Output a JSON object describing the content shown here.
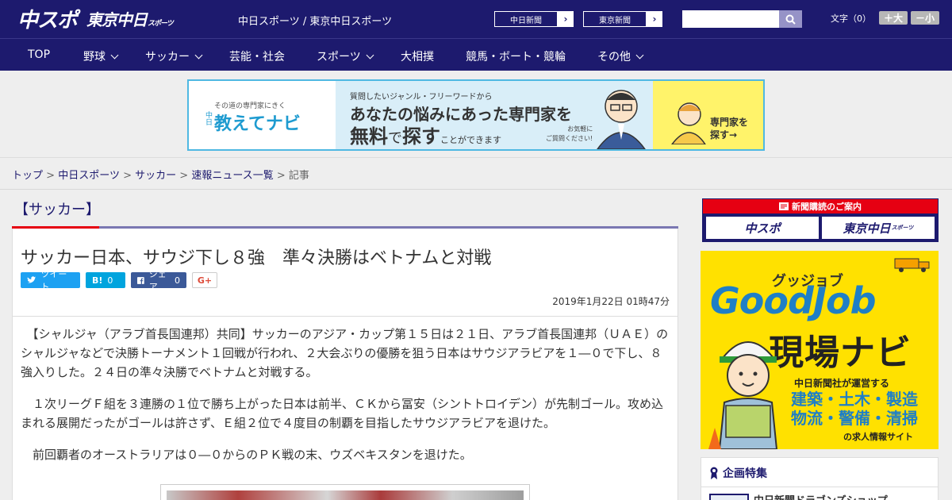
{
  "header": {
    "logo_main": "中スポ",
    "logo_tokyo": "東京中日",
    "logo_tokyo_small": "スポーツ",
    "site_names": "中日スポーツ / 東京中日スポーツ",
    "links": [
      {
        "label": "中日新聞",
        "arrow": "›"
      },
      {
        "label": "東京新聞",
        "arrow": "›"
      }
    ],
    "search_placeholder": "",
    "font_size_label": "文字（0）",
    "font_larger": "＋大",
    "font_smaller": "－小",
    "search_icon": "search-icon"
  },
  "nav": {
    "items": [
      {
        "label": "TOP",
        "dropdown": false
      },
      {
        "label": "野球",
        "dropdown": true
      },
      {
        "label": "サッカー",
        "dropdown": true
      },
      {
        "label": "芸能・社会",
        "dropdown": false
      },
      {
        "label": "スポーツ",
        "dropdown": true
      },
      {
        "label": "大相撲",
        "dropdown": false
      },
      {
        "label": "競馬・ボート・競輪",
        "dropdown": false
      },
      {
        "label": "その他",
        "dropdown": true
      }
    ]
  },
  "banner": {
    "tagline": "その道の専門家にきく",
    "brand_prefix": "中日",
    "brand": "教えてナビ",
    "question": "質問したいジャンル・フリーワードから",
    "headline1": "あなたの悩みにあった専門家を",
    "headline2_a": "無料",
    "headline2_b": "で",
    "headline2_c": "探す",
    "headline2_d": "ことができます",
    "note1": "お気軽に",
    "note2": "ご質問ください!",
    "cta1": "専門家を",
    "cta2": "探す→"
  },
  "breadcrumb": {
    "items": [
      "トップ",
      "中日スポーツ",
      "サッカー",
      "速報ニュース一覧"
    ],
    "current": "記事",
    "separator": ">"
  },
  "article": {
    "category": "【サッカー】",
    "title": "サッカー日本、サウジ下し８強　準々決勝はベトナムと対戦",
    "share": {
      "tweet": "ツイート",
      "hatena_count": "0",
      "hatena_label": "B!",
      "facebook_label": "シェア",
      "facebook_count": "0",
      "gplus": "G+"
    },
    "date": "2019年1月22日 01時47分",
    "paragraphs": [
      "　【シャルジャ（アラブ首長国連邦）共同】サッカーのアジア・カップ第１５日は２１日、アラブ首長国連邦（ＵＡＥ）のシャルジャなどで決勝トーナメント１回戦が行われ、２大会ぶりの優勝を狙う日本はサウジアラビアを１―０で下し、８強入りした。２４日の準々決勝でベトナムと対戦する。",
      "　１次リーグＦ組を３連勝の１位で勝ち上がった日本は前半、ＣＫから冨安（シントトロイデン）が先制ゴール。攻め込まれる展開だったがゴールは許さず、Ｅ組２位で４度目の制覇を目指したサウジアラビアを退けた。",
      "　前回覇者のオーストラリアは０―０からのＰＫ戦の末、ウズベキスタンを退けた。"
    ]
  },
  "sidebar": {
    "subscribe_title": "新聞購読のご案内",
    "subscribe_a": "中スポ",
    "subscribe_b": "東京中日",
    "subscribe_b_small": "スポーツ",
    "goodjob_kana": "グッジョブ",
    "goodjob_title": "GoodJob",
    "goodjob_navi": "現場ナビ",
    "goodjob_operator": "中日新聞社が運営する",
    "goodjob_cats1": "建築・土木・製造",
    "goodjob_cats2": "物流・警備・清掃",
    "goodjob_site": "の求人情報サイト",
    "special_title": "企画特集",
    "special_item": "中日新聞ドラゴンズショップ"
  },
  "colors": {
    "brand_navy": "#1d1a6e",
    "accent_red": "#e60012",
    "banner_blue": "#4fb8e2",
    "goodjob_yellow": "#ffe100",
    "goodjob_blue": "#1f7fc6"
  }
}
